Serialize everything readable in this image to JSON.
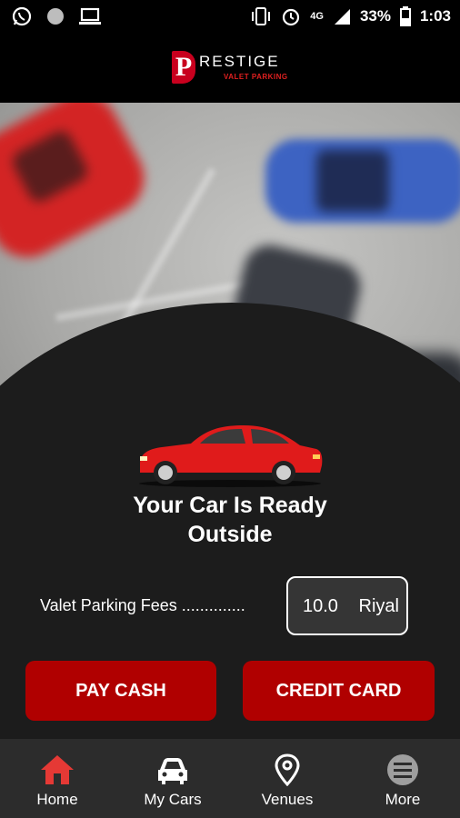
{
  "status_bar": {
    "battery": "33%",
    "time": "1:03",
    "network": "4G"
  },
  "header": {
    "logo_letter": "P",
    "logo_name": "RESTIGE",
    "logo_subtitle": "VALET PARKING"
  },
  "message": {
    "line1": "Your Car Is Ready",
    "line2": "Outside"
  },
  "fees": {
    "label": "Valet Parking Fees ..............",
    "amount": "10.0",
    "unit": "Riyal"
  },
  "actions": {
    "pay_cash": "PAY CASH",
    "credit_card": "CREDIT CARD"
  },
  "nav": {
    "items": [
      {
        "label": "Home",
        "icon": "home-icon"
      },
      {
        "label": "My Cars",
        "icon": "car-icon"
      },
      {
        "label": "Venues",
        "icon": "location-pin-icon"
      },
      {
        "label": "More",
        "icon": "menu-icon"
      }
    ]
  },
  "colors": {
    "brand_red": "#c8001e",
    "button_red": "#b00000",
    "nav_active": "#e53935"
  }
}
